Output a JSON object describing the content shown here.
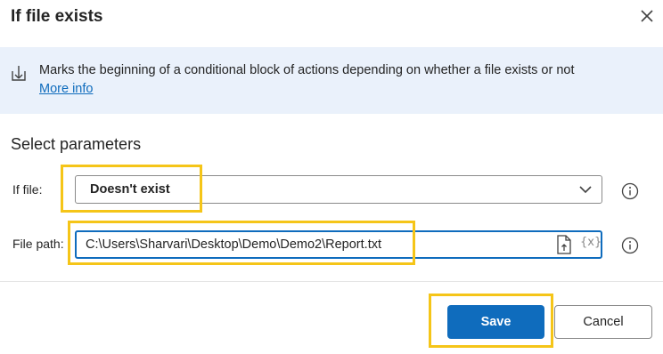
{
  "dialog": {
    "title": "If file exists",
    "description": "Marks the beginning of a conditional block of actions depending on whether a file exists or not",
    "more_info": "More info",
    "section_title": "Select parameters"
  },
  "fields": {
    "if_file": {
      "label": "If file:",
      "value": "Doesn't exist"
    },
    "file_path": {
      "label": "File path:",
      "value": "C:\\Users\\Sharvari\\Desktop\\Demo\\Demo2\\Report.txt",
      "variable_button": "{x}"
    }
  },
  "buttons": {
    "save": "Save",
    "cancel": "Cancel"
  },
  "colors": {
    "accent": "#0f6cbd",
    "banner_bg": "#eaf1fb",
    "highlight": "#f5c518"
  }
}
